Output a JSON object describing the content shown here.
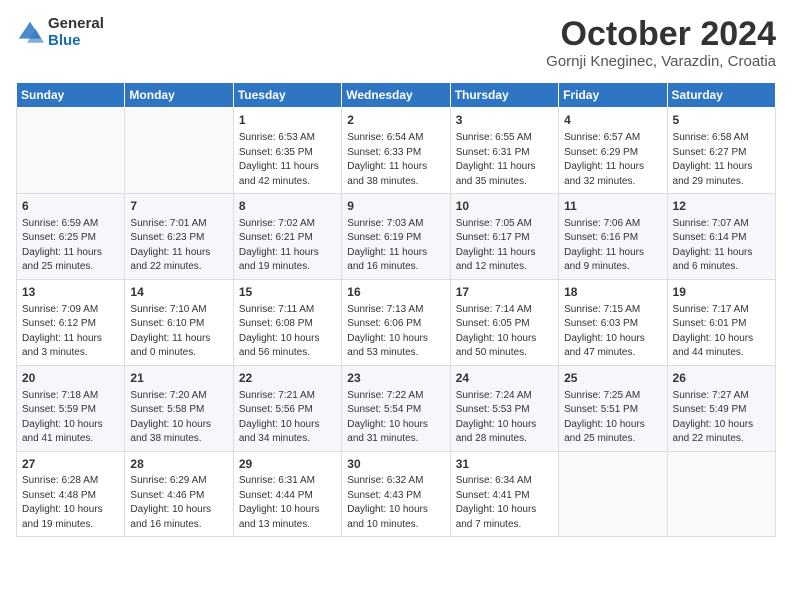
{
  "header": {
    "logo_general": "General",
    "logo_blue": "Blue",
    "month_title": "October 2024",
    "subtitle": "Gornji Kneginec, Varazdin, Croatia"
  },
  "days_of_week": [
    "Sunday",
    "Monday",
    "Tuesday",
    "Wednesday",
    "Thursday",
    "Friday",
    "Saturday"
  ],
  "weeks": [
    [
      {
        "day": "",
        "info": ""
      },
      {
        "day": "",
        "info": ""
      },
      {
        "day": "1",
        "info": "Sunrise: 6:53 AM\nSunset: 6:35 PM\nDaylight: 11 hours and 42 minutes."
      },
      {
        "day": "2",
        "info": "Sunrise: 6:54 AM\nSunset: 6:33 PM\nDaylight: 11 hours and 38 minutes."
      },
      {
        "day": "3",
        "info": "Sunrise: 6:55 AM\nSunset: 6:31 PM\nDaylight: 11 hours and 35 minutes."
      },
      {
        "day": "4",
        "info": "Sunrise: 6:57 AM\nSunset: 6:29 PM\nDaylight: 11 hours and 32 minutes."
      },
      {
        "day": "5",
        "info": "Sunrise: 6:58 AM\nSunset: 6:27 PM\nDaylight: 11 hours and 29 minutes."
      }
    ],
    [
      {
        "day": "6",
        "info": "Sunrise: 6:59 AM\nSunset: 6:25 PM\nDaylight: 11 hours and 25 minutes."
      },
      {
        "day": "7",
        "info": "Sunrise: 7:01 AM\nSunset: 6:23 PM\nDaylight: 11 hours and 22 minutes."
      },
      {
        "day": "8",
        "info": "Sunrise: 7:02 AM\nSunset: 6:21 PM\nDaylight: 11 hours and 19 minutes."
      },
      {
        "day": "9",
        "info": "Sunrise: 7:03 AM\nSunset: 6:19 PM\nDaylight: 11 hours and 16 minutes."
      },
      {
        "day": "10",
        "info": "Sunrise: 7:05 AM\nSunset: 6:17 PM\nDaylight: 11 hours and 12 minutes."
      },
      {
        "day": "11",
        "info": "Sunrise: 7:06 AM\nSunset: 6:16 PM\nDaylight: 11 hours and 9 minutes."
      },
      {
        "day": "12",
        "info": "Sunrise: 7:07 AM\nSunset: 6:14 PM\nDaylight: 11 hours and 6 minutes."
      }
    ],
    [
      {
        "day": "13",
        "info": "Sunrise: 7:09 AM\nSunset: 6:12 PM\nDaylight: 11 hours and 3 minutes."
      },
      {
        "day": "14",
        "info": "Sunrise: 7:10 AM\nSunset: 6:10 PM\nDaylight: 11 hours and 0 minutes."
      },
      {
        "day": "15",
        "info": "Sunrise: 7:11 AM\nSunset: 6:08 PM\nDaylight: 10 hours and 56 minutes."
      },
      {
        "day": "16",
        "info": "Sunrise: 7:13 AM\nSunset: 6:06 PM\nDaylight: 10 hours and 53 minutes."
      },
      {
        "day": "17",
        "info": "Sunrise: 7:14 AM\nSunset: 6:05 PM\nDaylight: 10 hours and 50 minutes."
      },
      {
        "day": "18",
        "info": "Sunrise: 7:15 AM\nSunset: 6:03 PM\nDaylight: 10 hours and 47 minutes."
      },
      {
        "day": "19",
        "info": "Sunrise: 7:17 AM\nSunset: 6:01 PM\nDaylight: 10 hours and 44 minutes."
      }
    ],
    [
      {
        "day": "20",
        "info": "Sunrise: 7:18 AM\nSunset: 5:59 PM\nDaylight: 10 hours and 41 minutes."
      },
      {
        "day": "21",
        "info": "Sunrise: 7:20 AM\nSunset: 5:58 PM\nDaylight: 10 hours and 38 minutes."
      },
      {
        "day": "22",
        "info": "Sunrise: 7:21 AM\nSunset: 5:56 PM\nDaylight: 10 hours and 34 minutes."
      },
      {
        "day": "23",
        "info": "Sunrise: 7:22 AM\nSunset: 5:54 PM\nDaylight: 10 hours and 31 minutes."
      },
      {
        "day": "24",
        "info": "Sunrise: 7:24 AM\nSunset: 5:53 PM\nDaylight: 10 hours and 28 minutes."
      },
      {
        "day": "25",
        "info": "Sunrise: 7:25 AM\nSunset: 5:51 PM\nDaylight: 10 hours and 25 minutes."
      },
      {
        "day": "26",
        "info": "Sunrise: 7:27 AM\nSunset: 5:49 PM\nDaylight: 10 hours and 22 minutes."
      }
    ],
    [
      {
        "day": "27",
        "info": "Sunrise: 6:28 AM\nSunset: 4:48 PM\nDaylight: 10 hours and 19 minutes."
      },
      {
        "day": "28",
        "info": "Sunrise: 6:29 AM\nSunset: 4:46 PM\nDaylight: 10 hours and 16 minutes."
      },
      {
        "day": "29",
        "info": "Sunrise: 6:31 AM\nSunset: 4:44 PM\nDaylight: 10 hours and 13 minutes."
      },
      {
        "day": "30",
        "info": "Sunrise: 6:32 AM\nSunset: 4:43 PM\nDaylight: 10 hours and 10 minutes."
      },
      {
        "day": "31",
        "info": "Sunrise: 6:34 AM\nSunset: 4:41 PM\nDaylight: 10 hours and 7 minutes."
      },
      {
        "day": "",
        "info": ""
      },
      {
        "day": "",
        "info": ""
      }
    ]
  ]
}
